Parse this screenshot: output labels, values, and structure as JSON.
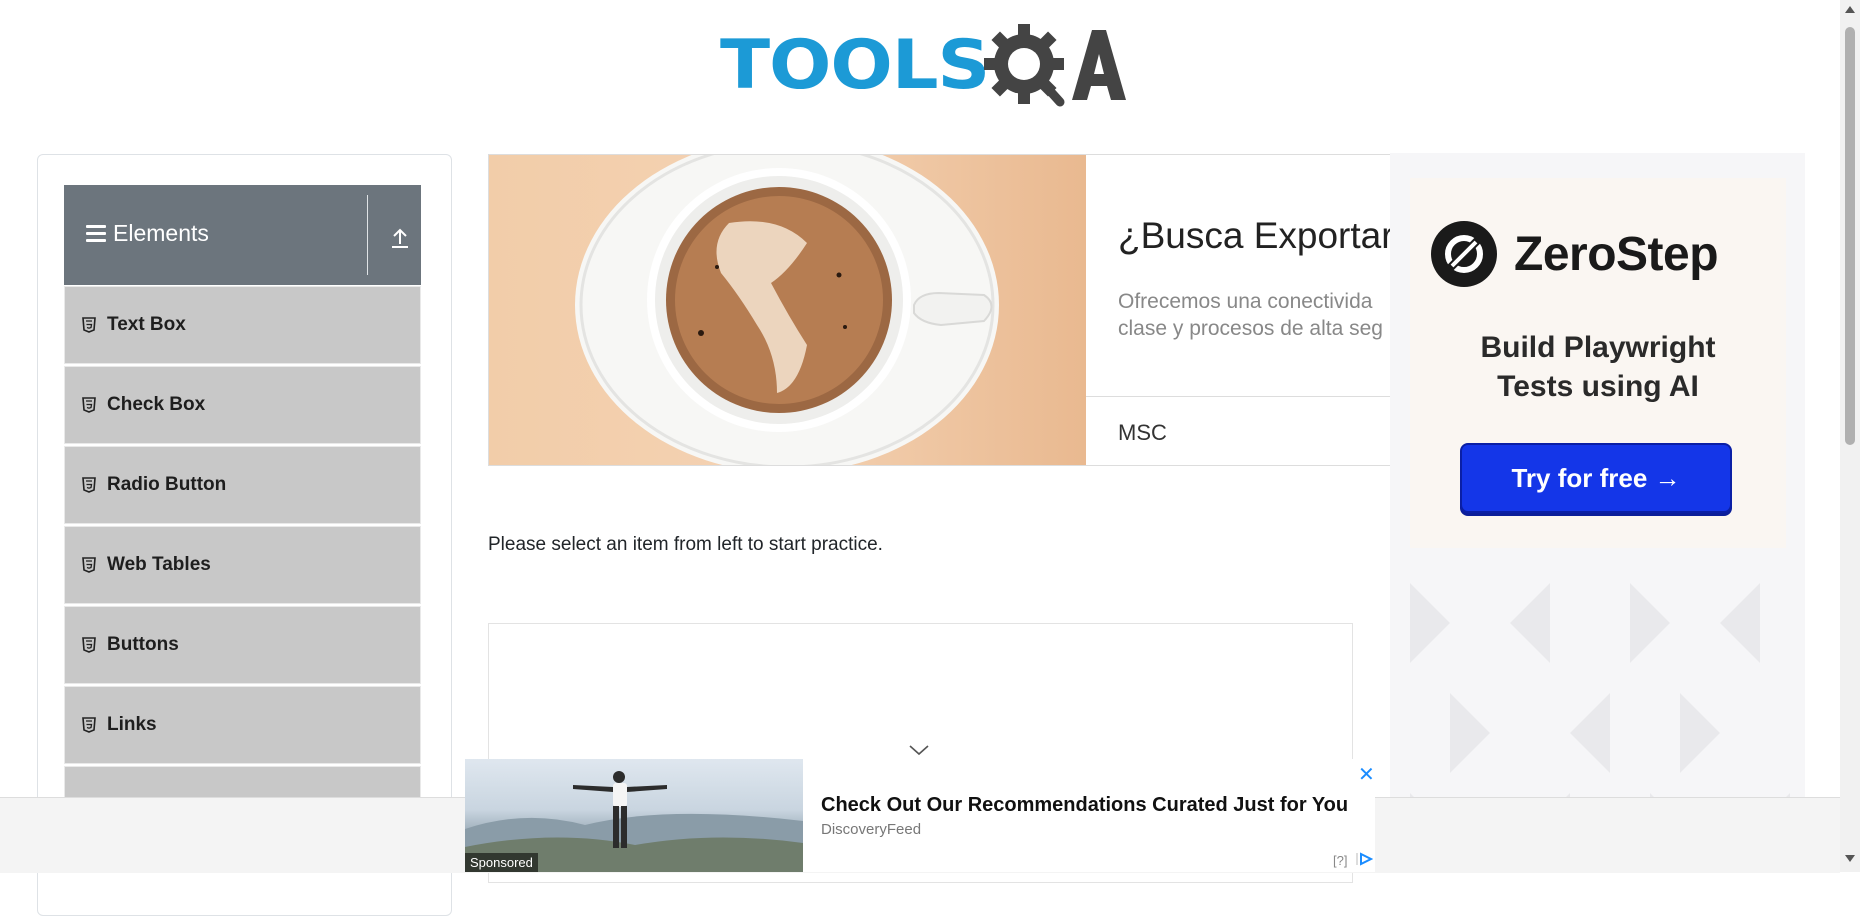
{
  "header": {
    "logo_text": "TOOLS",
    "logo_suffix": "QA"
  },
  "sidebar": {
    "group_title": "Elements",
    "items": [
      {
        "label": "Text Box"
      },
      {
        "label": "Check Box"
      },
      {
        "label": "Radio Button"
      },
      {
        "label": "Web Tables"
      },
      {
        "label": "Buttons"
      },
      {
        "label": "Links"
      },
      {
        "label": ""
      }
    ]
  },
  "banner_ad": {
    "headline": "¿Busca Exportar",
    "description_line1": "Ofrecemos una conectivida",
    "description_line2": "clase y procesos de alta seg",
    "brand": "MSC"
  },
  "main": {
    "instruction": "Please select an item from left to start practice."
  },
  "right_ad": {
    "brand": "ZeroStep",
    "tagline_line1": "Build Playwright",
    "tagline_line2": "Tests using AI",
    "cta": "Try for free →"
  },
  "sponsored_ad": {
    "label": "Sponsored",
    "title": "Check Out Our Recommendations Curated Just for You",
    "source": "DiscoveryFeed",
    "help": "[?]",
    "close": "✕"
  },
  "colors": {
    "logo_blue": "#1c9ad6",
    "sidebar_header": "#6c757d",
    "sidebar_item": "#c8c8c8",
    "cta_blue": "#1436e8"
  }
}
